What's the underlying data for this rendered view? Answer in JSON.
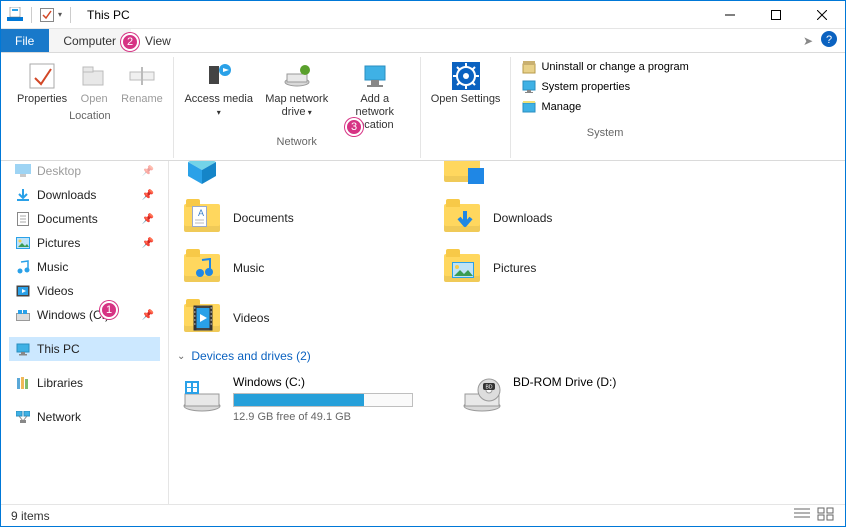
{
  "window": {
    "title": "This PC",
    "min_tip": "Minimize",
    "max_tip": "Maximize",
    "close_tip": "Close"
  },
  "tabs": {
    "file": "File",
    "computer": "Computer",
    "view": "View"
  },
  "ribbon": {
    "location": {
      "label": "Location",
      "properties": "Properties",
      "open": "Open",
      "rename": "Rename"
    },
    "network": {
      "label": "Network",
      "access_media": "Access media",
      "map_drive": "Map network drive",
      "add_location": "Add a network location"
    },
    "settings": {
      "open_settings": "Open Settings"
    },
    "system": {
      "label": "System",
      "uninstall": "Uninstall or change a program",
      "sys_props": "System properties",
      "manage": "Manage"
    }
  },
  "nav": {
    "desktop": "Desktop",
    "downloads": "Downloads",
    "documents": "Documents",
    "pictures": "Pictures",
    "music": "Music",
    "videos": "Videos",
    "windows_c": "Windows (C:)",
    "this_pc": "This PC",
    "libraries": "Libraries",
    "network": "Network"
  },
  "content": {
    "folders": [
      {
        "label": "Documents"
      },
      {
        "label": "Downloads"
      },
      {
        "label": "Music"
      },
      {
        "label": "Pictures"
      },
      {
        "label": "Videos"
      }
    ],
    "top_folders": [
      {
        "label": ""
      },
      {
        "label": ""
      }
    ],
    "drives_header": "Devices and drives (2)",
    "drives": {
      "c": {
        "name": "Windows (C:)",
        "free_text": "12.9 GB free of 49.1 GB",
        "fill_pct": 73
      },
      "d": {
        "name": "BD-ROM Drive (D:)"
      }
    }
  },
  "status": {
    "items": "9 items"
  },
  "annotations": {
    "a1": "1",
    "a2": "2",
    "a3": "3"
  }
}
